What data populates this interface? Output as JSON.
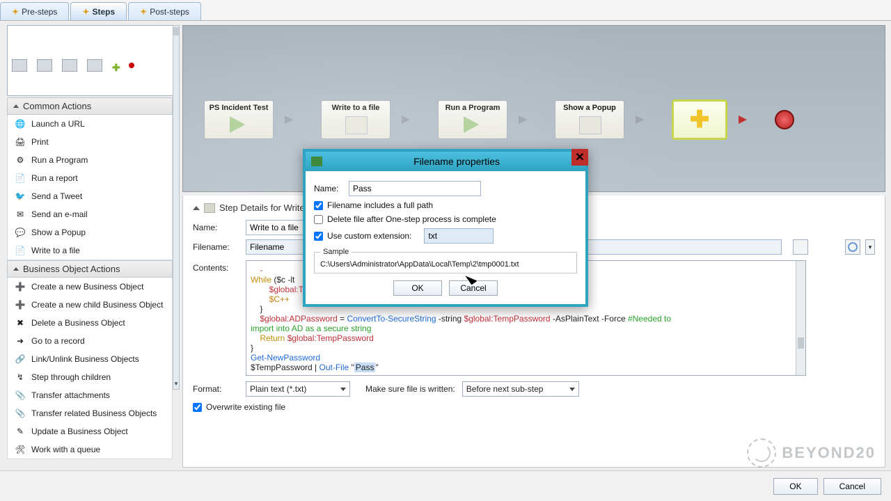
{
  "tabs": {
    "pre": "Pre-steps",
    "steps": "Steps",
    "post": "Post-steps"
  },
  "actions": {
    "common_header": "Common Actions",
    "business_header": "Business Object Actions",
    "common": [
      "Launch a URL",
      "Print",
      "Run a Program",
      "Run a report",
      "Send a Tweet",
      "Send an e-mail",
      "Show a Popup",
      "Write to a file"
    ],
    "business": [
      "Create a new Business Object",
      "Create a new child Business Object",
      "Delete a Business Object",
      "Go to a record",
      "Link/Unlink Business Objects",
      "Step through children",
      "Transfer attachments",
      "Transfer related Business Objects",
      "Update a Business Object",
      "Work with a queue"
    ]
  },
  "nodes": {
    "n1": "PS Incident Test",
    "n2": "Write to a file",
    "n3": "Run a Program",
    "n4": "Show a Popup"
  },
  "details": {
    "title": "Step Details for Write to a file",
    "name_lbl": "Name:",
    "name_value": "Write to a file",
    "filename_lbl": "Filename:",
    "filename_value": "Filename",
    "contents_lbl": "Contents:",
    "format_lbl": "Format:",
    "format_val": "Plain text (*.txt)",
    "written_lbl": "Make sure file is written:",
    "written_val": "Before next sub-step",
    "overwrite_lbl": "Overwrite existing file"
  },
  "code": {
    "while": "While ",
    "wcond": "($c -lt",
    "line2": "$global:Tem",
    "line3": "        $C++",
    "line4": "    }",
    "line5a": "    ",
    "line5g": "$global:ADPassword",
    "line5eq": " = ",
    "line5cmd": "ConvertTo-SecureString",
    "line5p": " -string ",
    "line5g2": "$global:TempPassword",
    "line5r": " -AsPlainText -Force ",
    "line5c": "#Needed to",
    "line6": "import into AD as a secure string",
    "line7a": "    Return ",
    "line7g": "$global:TempPassword",
    "line8": "}",
    "line9": "Get-NewPassword",
    "line10a": "$TempPassword | ",
    "line10b": "Out-File ",
    "line10q": "\"",
    "line10s": "Pass",
    "line10q2": "\""
  },
  "dialog": {
    "title": "Filename properties",
    "name_lbl": "Name:",
    "name_val": "Pass",
    "fullpath": "Filename includes a full path",
    "delete": "Delete file after One-step process is complete",
    "ext_lbl": "Use custom extension:",
    "ext_val": "txt",
    "sample_legend": "Sample",
    "sample_val": "C:\\Users\\Administrator\\AppData\\Local\\Temp\\2\\tmp0001.txt",
    "ok": "OK",
    "cancel": "Cancel"
  },
  "bottom": {
    "ok": "OK",
    "cancel": "Cancel"
  },
  "watermark": "BEYOND20"
}
